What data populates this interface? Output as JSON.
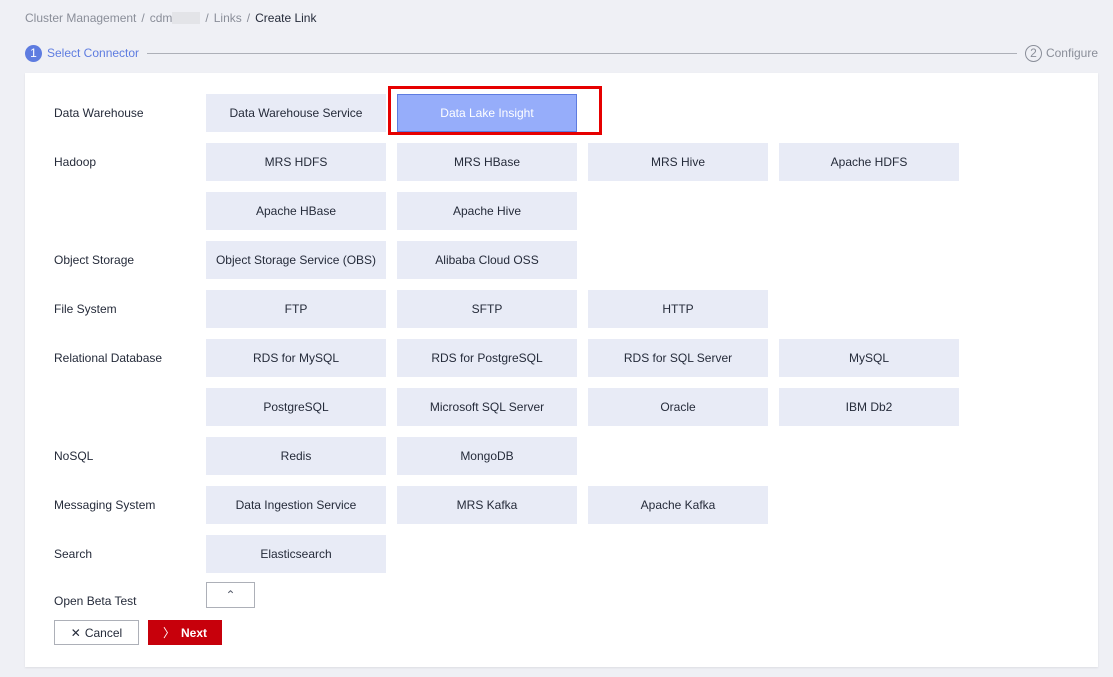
{
  "breadcrumb": {
    "items": [
      "Cluster Management",
      "cdm",
      "Links"
    ],
    "current": "Create Link"
  },
  "steps": [
    {
      "num": "1",
      "label": "Select Connector"
    },
    {
      "num": "2",
      "label": "Configure"
    }
  ],
  "groups": [
    {
      "label": "Data Warehouse",
      "items": [
        "Data Warehouse Service",
        "Data Lake Insight"
      ]
    },
    {
      "label": "Hadoop",
      "items": [
        "MRS HDFS",
        "MRS HBase",
        "MRS Hive",
        "Apache HDFS",
        "Apache HBase",
        "Apache Hive"
      ]
    },
    {
      "label": "Object Storage",
      "items": [
        "Object Storage Service (OBS)",
        "Alibaba Cloud OSS"
      ]
    },
    {
      "label": "File System",
      "items": [
        "FTP",
        "SFTP",
        "HTTP"
      ]
    },
    {
      "label": "Relational Database",
      "items": [
        "RDS for MySQL",
        "RDS for PostgreSQL",
        "RDS for SQL Server",
        "MySQL",
        "PostgreSQL",
        "Microsoft SQL Server",
        "Oracle",
        "IBM Db2"
      ]
    },
    {
      "label": "NoSQL",
      "items": [
        "Redis",
        "MongoDB"
      ]
    },
    {
      "label": "Messaging System",
      "items": [
        "Data Ingestion Service",
        "MRS Kafka",
        "Apache Kafka"
      ]
    },
    {
      "label": "Search",
      "items": [
        "Elasticsearch"
      ]
    }
  ],
  "selected": "Data Lake Insight",
  "open_beta": {
    "label": "Open Beta Test",
    "toggle_icon": "chevron-up-icon",
    "toggle_glyph": "⌃"
  },
  "actions": {
    "cancel": "Cancel",
    "cancel_glyph": "✕",
    "next": "Next",
    "next_glyph": "〉"
  },
  "colors": {
    "accent": "#5e7ce0",
    "selected": "#96adfa",
    "primary": "#c7000b",
    "highlight": "#e60000"
  }
}
